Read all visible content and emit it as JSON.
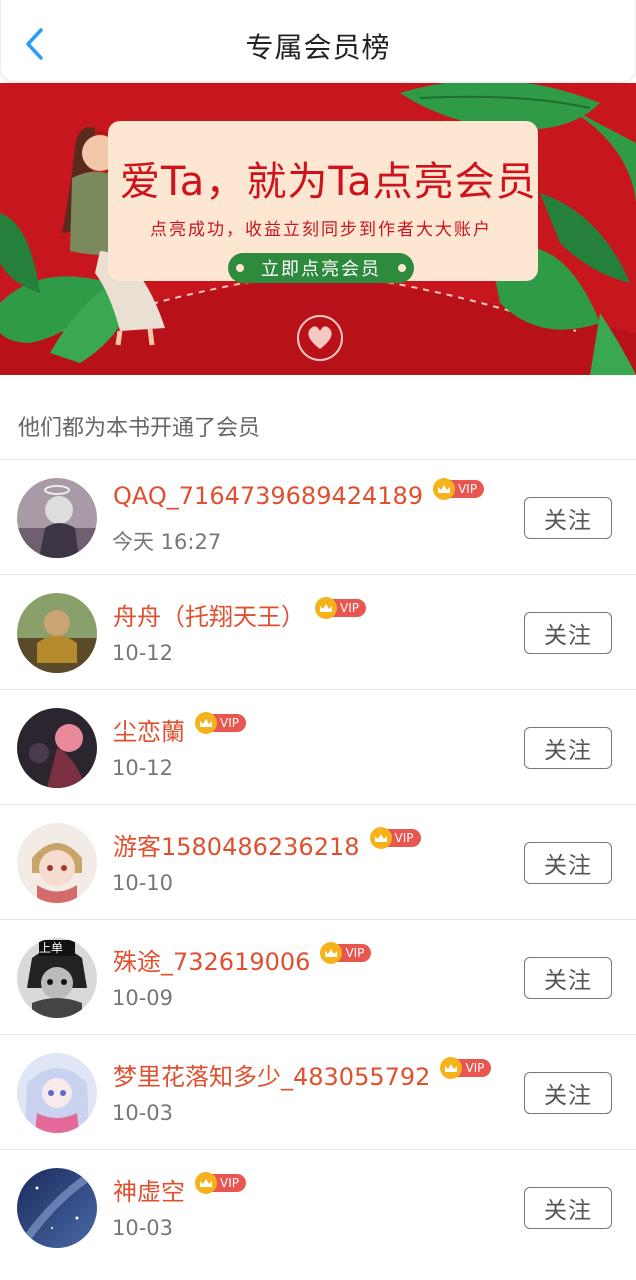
{
  "header": {
    "title": "专属会员榜",
    "back_icon": "chevron-left-icon"
  },
  "banner": {
    "headline": "爱Ta，就为Ta点亮会员",
    "subtitle": "点亮成功，收益立刻同步到作者大大账户",
    "cta_label": "立即点亮会员"
  },
  "section": {
    "title": "他们都为本书开通了会员"
  },
  "colors": {
    "accent": "#e0502f",
    "banner_red": "#c8161e",
    "cta_green": "#2e8b3e",
    "vip_gold": "#f6b21b",
    "back_blue": "#2a9df4"
  },
  "members": [
    {
      "name": "QAQ_7164739689424189",
      "vip": "VIP",
      "time": "今天 16:27",
      "follow": "关注"
    },
    {
      "name": "舟舟（托翔天王）",
      "vip": "VIP",
      "time": "10-12",
      "follow": "关注"
    },
    {
      "name": "尘恋蘭",
      "vip": "VIP",
      "time": "10-12",
      "follow": "关注"
    },
    {
      "name": "游客1580486236218",
      "vip": "VIP",
      "time": "10-10",
      "follow": "关注"
    },
    {
      "name": "殊途_732619006",
      "vip": "VIP",
      "time": "10-09",
      "follow": "关注"
    },
    {
      "name": "梦里花落知多少_483055792",
      "vip": "VIP",
      "time": "10-03",
      "follow": "关注"
    },
    {
      "name": "神虚空",
      "vip": "VIP",
      "time": "10-03",
      "follow": "关注"
    }
  ],
  "avatar_badge": "上单"
}
